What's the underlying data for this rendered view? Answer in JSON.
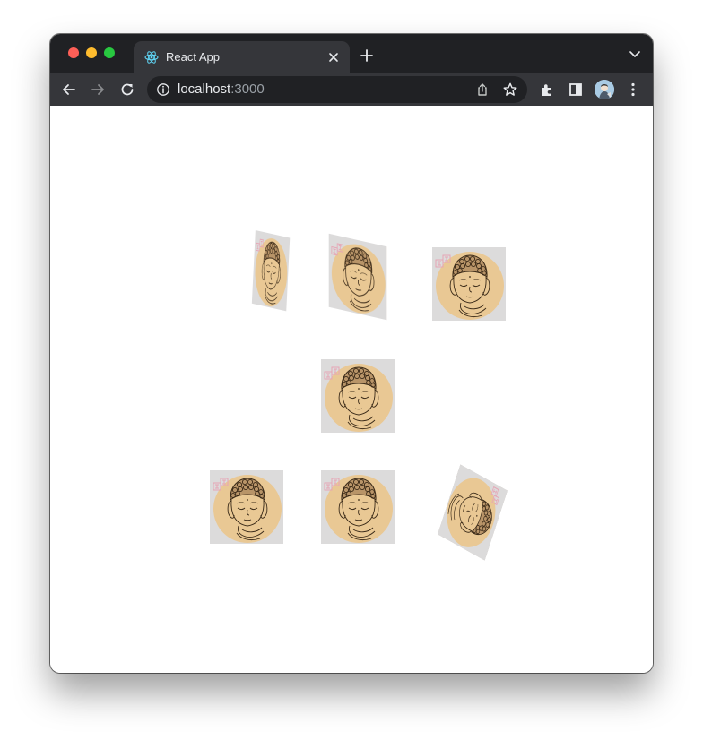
{
  "browser": {
    "tab_title": "React App",
    "url_host": "localhost",
    "url_port": ":3000"
  },
  "page": {
    "image_glyph": "法"
  },
  "colors": {
    "disc": "#e9c894",
    "card_bg": "#dcdbdb",
    "line": "#3a2a18",
    "stamp": "#e6a5b5"
  },
  "icons": [
    "react-icon",
    "close-icon",
    "plus-icon",
    "chevron-down-icon",
    "back-icon",
    "forward-icon",
    "reload-icon",
    "info-icon",
    "share-icon",
    "star-icon",
    "extensions-icon",
    "side-panel-icon",
    "avatar",
    "more-icon"
  ]
}
